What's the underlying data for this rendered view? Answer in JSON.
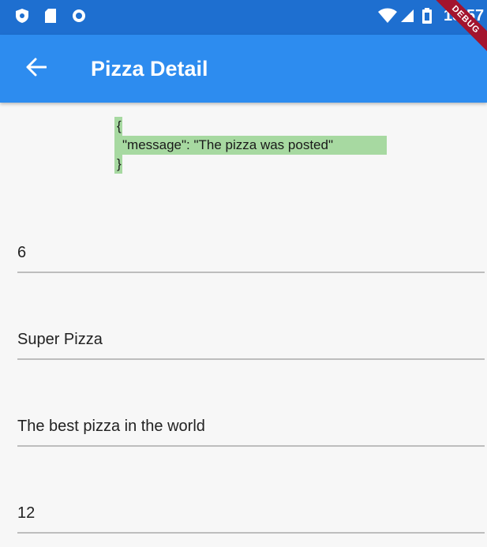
{
  "status_bar": {
    "time": "18:57",
    "icons": [
      "shield-icon",
      "sd-card-icon",
      "circle-icon",
      "wifi-icon",
      "signal-icon",
      "battery-icon"
    ],
    "color": "#1e6fd0"
  },
  "debug_banner": {
    "label": "DEBUG",
    "color": "#a3142e"
  },
  "app_bar": {
    "title": "Pizza Detail",
    "back_icon": "arrow-back-icon",
    "color": "#2d8cef"
  },
  "response": {
    "open": "{",
    "body": "\"message\": \"The pizza was posted\"",
    "close": "}",
    "highlight": "#a7d9a1"
  },
  "fields": [
    {
      "value": "6"
    },
    {
      "value": "Super Pizza"
    },
    {
      "value": "The best pizza in the world"
    },
    {
      "value": "12"
    }
  ]
}
